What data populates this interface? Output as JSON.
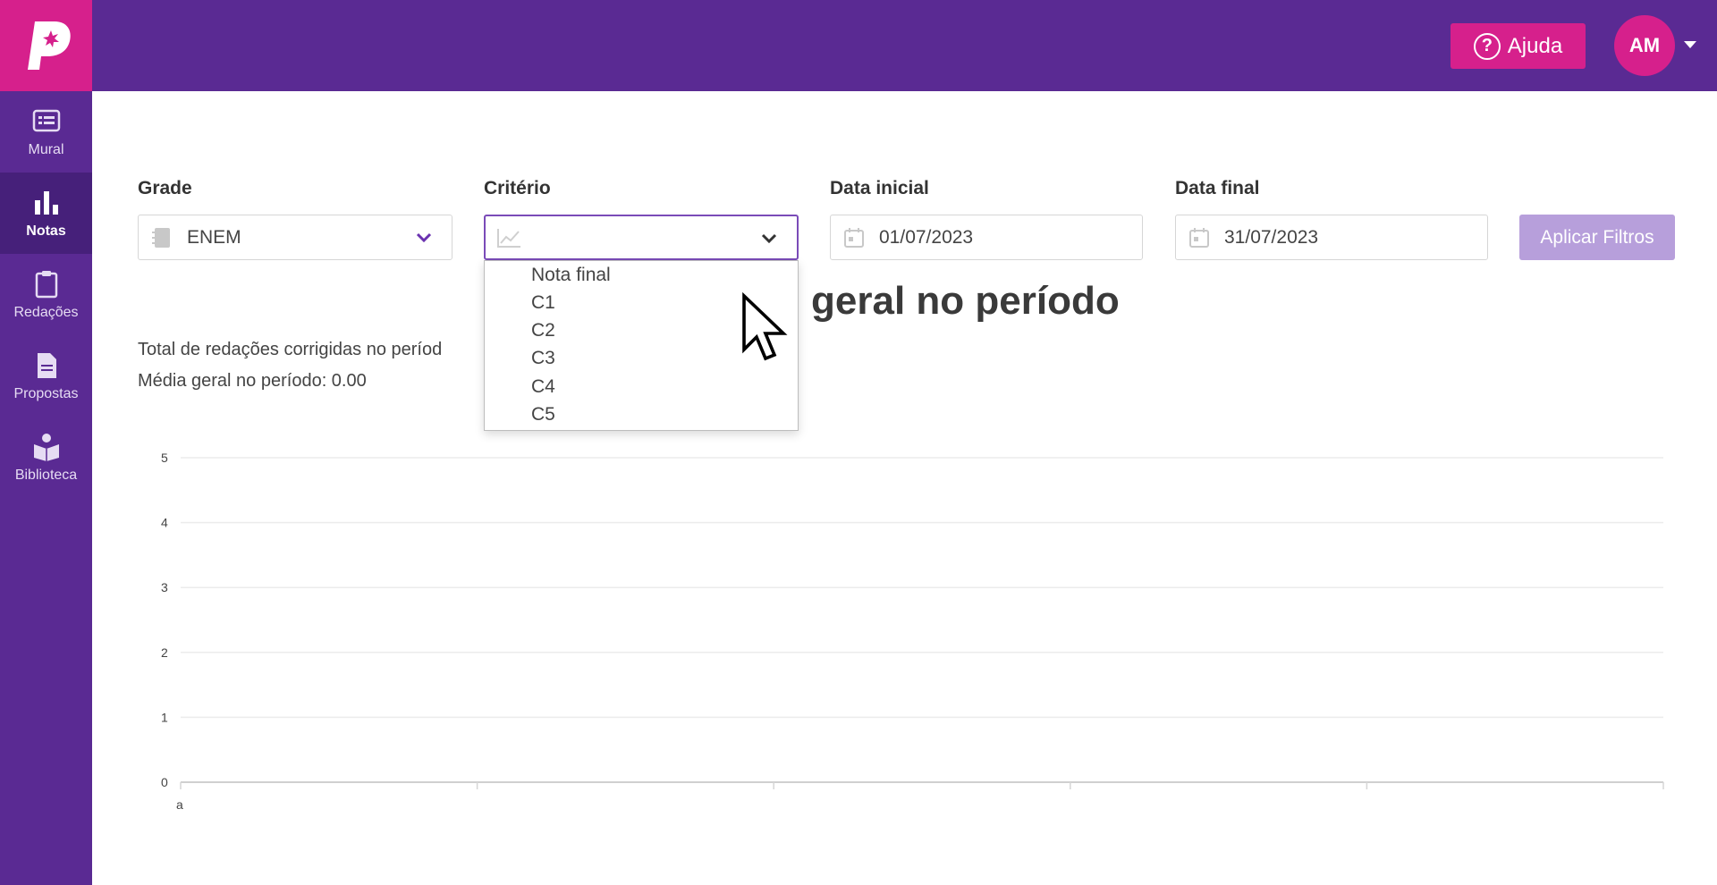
{
  "header": {
    "help_label": "Ajuda",
    "avatar_initials": "AM",
    "brand_color": "#d6208c",
    "bar_color": "#5a2a93"
  },
  "sidebar": {
    "items": [
      {
        "label": "Mural",
        "icon": "mural-icon"
      },
      {
        "label": "Notas",
        "icon": "bar-chart-icon",
        "active": true
      },
      {
        "label": "Redações",
        "icon": "clipboard-icon"
      },
      {
        "label": "Propostas",
        "icon": "document-icon"
      },
      {
        "label": "Biblioteca",
        "icon": "book-reader-icon"
      }
    ]
  },
  "filters": {
    "grade_label": "Grade",
    "grade_value": "ENEM",
    "criterio_label": "Critério",
    "criterio_value": "",
    "data_inicial_label": "Data inicial",
    "data_inicial_value": "01/07/2023",
    "data_final_label": "Data final",
    "data_final_value": "31/07/2023",
    "apply_label": "Aplicar Filtros"
  },
  "criterio_options": [
    "Nota final",
    "C1",
    "C2",
    "C3",
    "C4",
    "C5"
  ],
  "heading": "geral no período",
  "stats": {
    "total_label": "Total de redações corrigidas no períod",
    "media_label": "Média geral no período: 0.00"
  },
  "chart_data": {
    "type": "line",
    "title": "",
    "xlabel": "",
    "ylabel": "",
    "ylim": [
      0,
      5
    ],
    "yticks": [
      "0",
      "1",
      "2",
      "3",
      "4",
      "5"
    ],
    "xtick_label": "a",
    "series": [],
    "grid": true
  }
}
